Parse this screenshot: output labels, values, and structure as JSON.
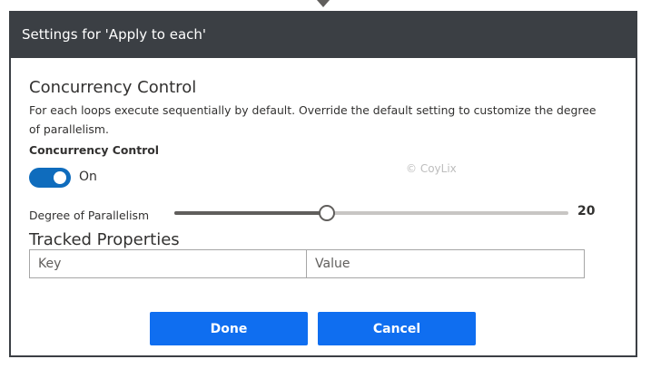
{
  "dialog": {
    "title": "Settings for 'Apply to each'"
  },
  "concurrency": {
    "section_title": "Concurrency Control",
    "description": "For each loops execute sequentially by default. Override the default setting to customize the degree of parallelism.",
    "field_label": "Concurrency Control",
    "toggle_state": "On",
    "toggle_on": true
  },
  "parallelism": {
    "label": "Degree of Parallelism",
    "value": "20",
    "min": 1,
    "max": 50,
    "current": 20
  },
  "tracked": {
    "title": "Tracked Properties",
    "key_placeholder": "Key",
    "value_placeholder": "Value"
  },
  "watermark": "© CoyLix",
  "buttons": {
    "done": "Done",
    "cancel": "Cancel"
  },
  "colors": {
    "header_bg": "#3b3f44",
    "toggle_on": "#0f6cbd",
    "primary_button": "#0f6ef0"
  }
}
